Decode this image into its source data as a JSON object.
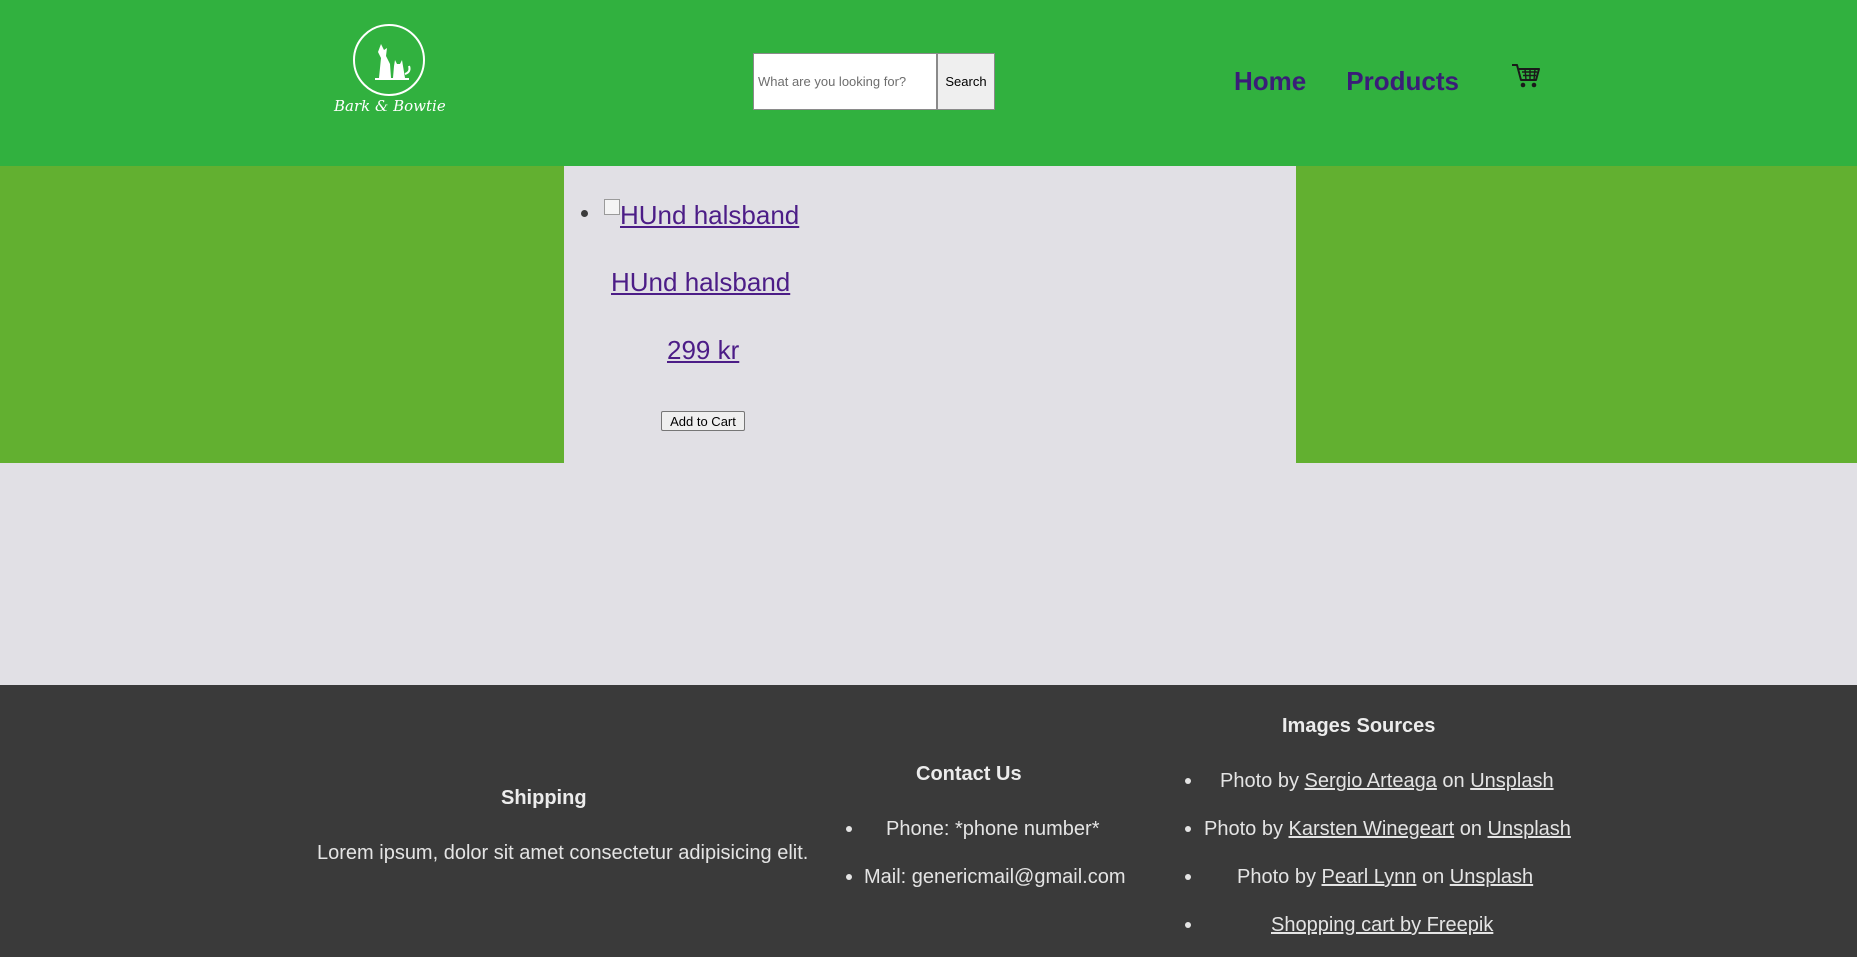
{
  "header": {
    "logo_text": "Bark & Bowtie",
    "search": {
      "placeholder": "What are you looking for?",
      "button_label": "Search"
    },
    "nav": [
      {
        "label": "Home"
      },
      {
        "label": "Products"
      }
    ],
    "cart_icon": "shopping-cart-icon",
    "colors": {
      "background": "#31b13f",
      "nav_text": "#3a1d78"
    }
  },
  "main": {
    "products": [
      {
        "image_alt": "HUnd halsband",
        "name": "HUnd halsband",
        "price": "299 kr",
        "add_to_cart_label": "Add to Cart"
      }
    ],
    "colors": {
      "band": "#62b030",
      "panel": "#e1e0e5",
      "link": "#4c1d87"
    }
  },
  "footer": {
    "shipping": {
      "title": "Shipping",
      "text": "Lorem ipsum, dolor sit amet consectetur adipisicing elit."
    },
    "contact": {
      "title": "Contact Us",
      "items": [
        "Phone: *phone number*",
        "Mail: genericmail@gmail.com"
      ]
    },
    "sources": {
      "title": "Images Sources",
      "items": [
        {
          "prefix": "Photo by ",
          "author": "Sergio Arteaga",
          "mid": " on ",
          "site": "Unsplash"
        },
        {
          "prefix": "Photo by ",
          "author": "Karsten Winegeart",
          "mid": " on ",
          "site": "Unsplash"
        },
        {
          "prefix": "Photo by ",
          "author": "Pearl Lynn",
          "mid": " on ",
          "site": "Unsplash"
        }
      ],
      "extra_link": "Shopping cart by Freepik"
    },
    "colors": {
      "background": "#3a3a3a",
      "text": "#e4e4e4"
    }
  }
}
